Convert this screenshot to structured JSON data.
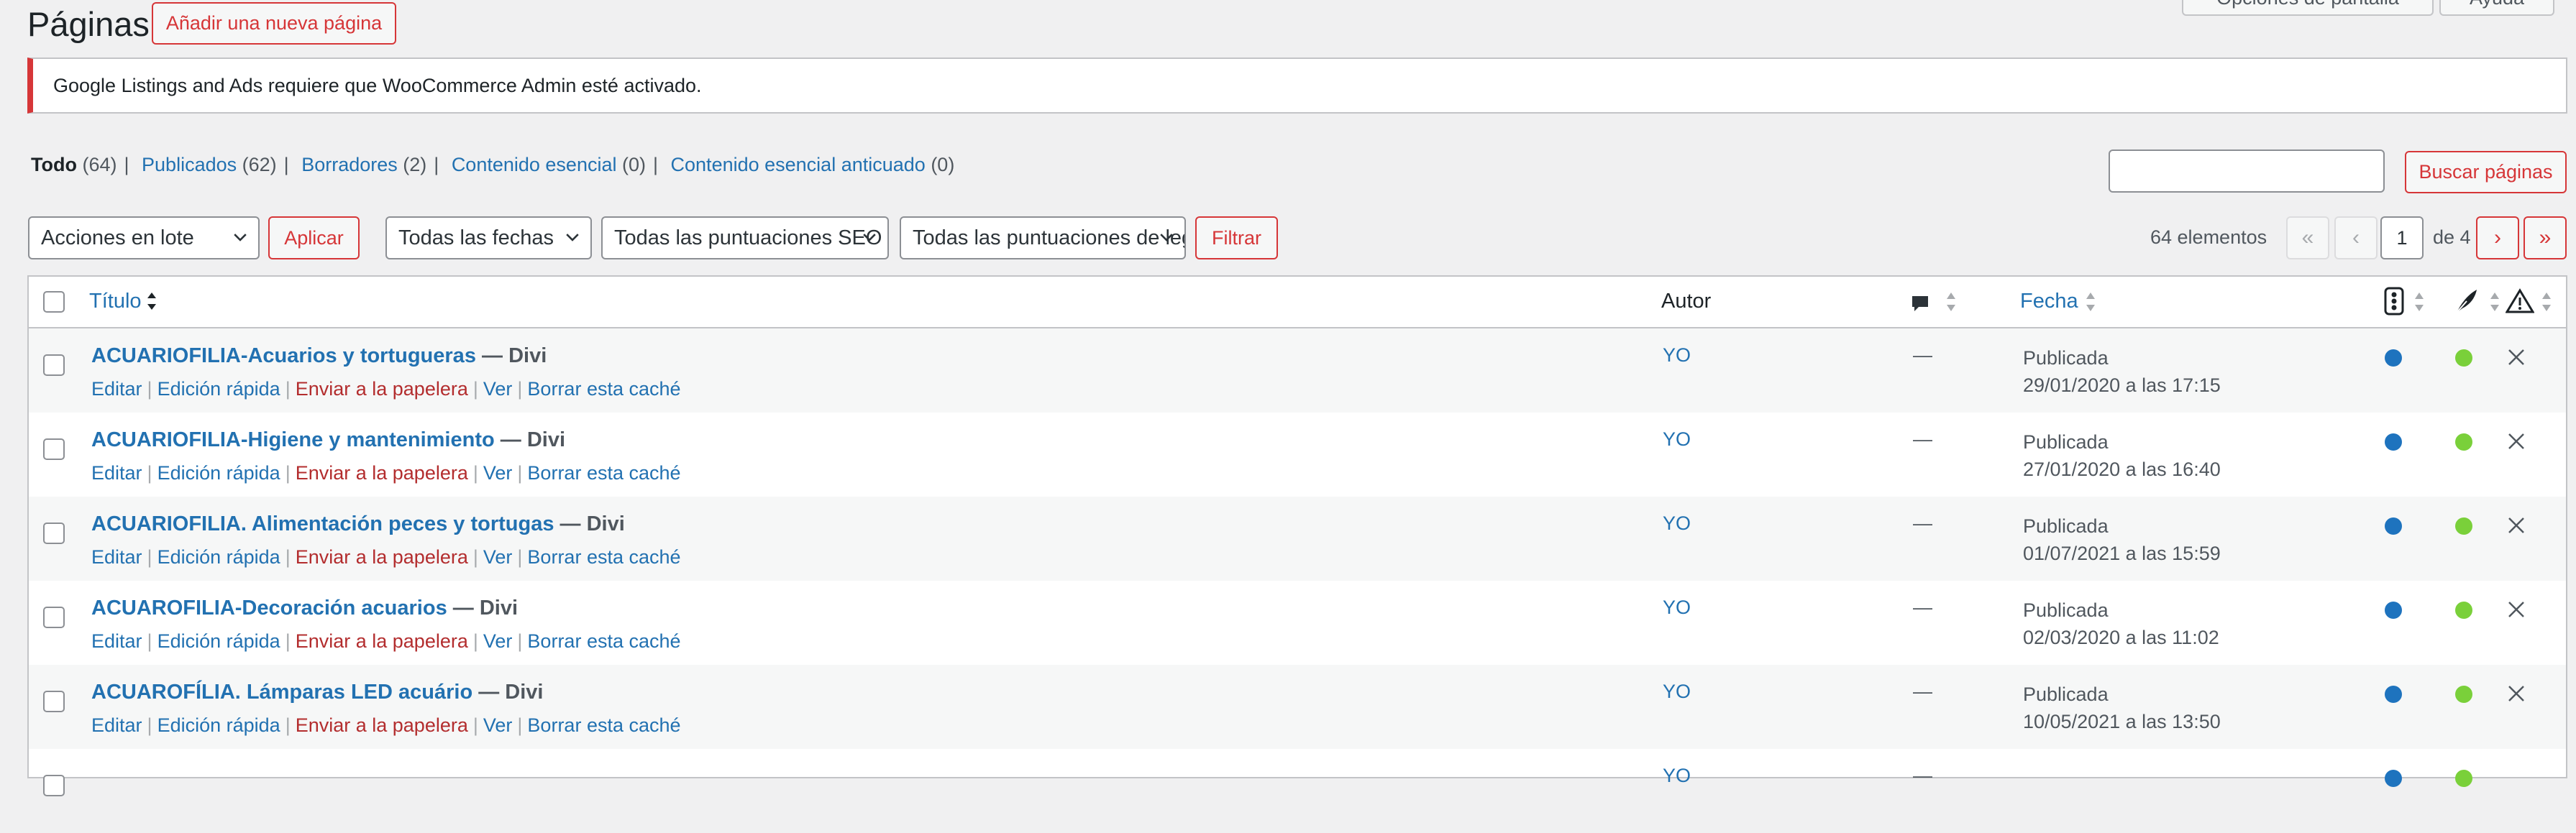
{
  "header": {
    "title": "Páginas",
    "add_new_label": "Añadir una nueva página",
    "screen_options_label": "Opciones de pantalla",
    "help_label": "Ayuda"
  },
  "notice": {
    "text": "Google Listings and Ads requiere que WooCommerce Admin esté activado."
  },
  "views": [
    {
      "label": "Todo",
      "count": "(64)"
    },
    {
      "label": "Publicados",
      "count": "(62)"
    },
    {
      "label": "Borradores",
      "count": "(2)"
    },
    {
      "label": "Contenido esencial",
      "count": "(0)"
    },
    {
      "label": "Contenido esencial anticuado",
      "count": "(0)"
    }
  ],
  "search": {
    "button_label": "Buscar páginas",
    "value": ""
  },
  "filters": {
    "bulk_actions": "Acciones en lote",
    "apply_label": "Aplicar",
    "dates": "Todas las fechas",
    "seo_scores": "Todas las puntuaciones SEO",
    "readability_scores": "Todas las puntuaciones de legibilidad",
    "filter_label": "Filtrar"
  },
  "pagination": {
    "items_count": "64 elementos",
    "first": "«",
    "prev": "‹",
    "current_page": "1",
    "of_label": "de 4",
    "next": "›",
    "last": "»"
  },
  "table": {
    "columns": {
      "title": "Título",
      "author": "Autor",
      "date": "Fecha"
    },
    "row_actions": {
      "edit": "Editar",
      "quick_edit": "Edición rápida",
      "trash": "Enviar a la papelera",
      "view": "Ver",
      "clear_cache": "Borrar esta caché"
    },
    "rows": [
      {
        "title": "ACUARIOFILIA-Acuarios y tortugueras",
        "state": " — Divi",
        "author": "YO",
        "comments": "—",
        "status": "Publicada",
        "date": "29/01/2020 a las 17:15"
      },
      {
        "title": "ACUARIOFILIA-Higiene y mantenimiento",
        "state": " — Divi",
        "author": "YO",
        "comments": "—",
        "status": "Publicada",
        "date": "27/01/2020 a las 16:40"
      },
      {
        "title": "ACUARIOFILIA. Alimentación peces y tortugas",
        "state": " — Divi",
        "author": "YO",
        "comments": "—",
        "status": "Publicada",
        "date": "01/07/2021 a las 15:59"
      },
      {
        "title": "ACUAROFILIA-Decoración acuarios",
        "state": " — Divi",
        "author": "YO",
        "comments": "—",
        "status": "Publicada",
        "date": "02/03/2020 a las 11:02"
      },
      {
        "title": "ACUAROFÍLIA. Lámparas LED acuário",
        "state": " — Divi",
        "author": "YO",
        "comments": "—",
        "status": "Publicada",
        "date": "10/05/2021 a las 13:50"
      },
      {
        "title": "",
        "state": "",
        "author": "YO",
        "comments": "—",
        "status": "",
        "date": ""
      }
    ]
  },
  "colors": {
    "accent": "#d63638",
    "link": "#2271b1",
    "seo_dot": "#1e73be",
    "readability_dot": "#7ad03a"
  }
}
